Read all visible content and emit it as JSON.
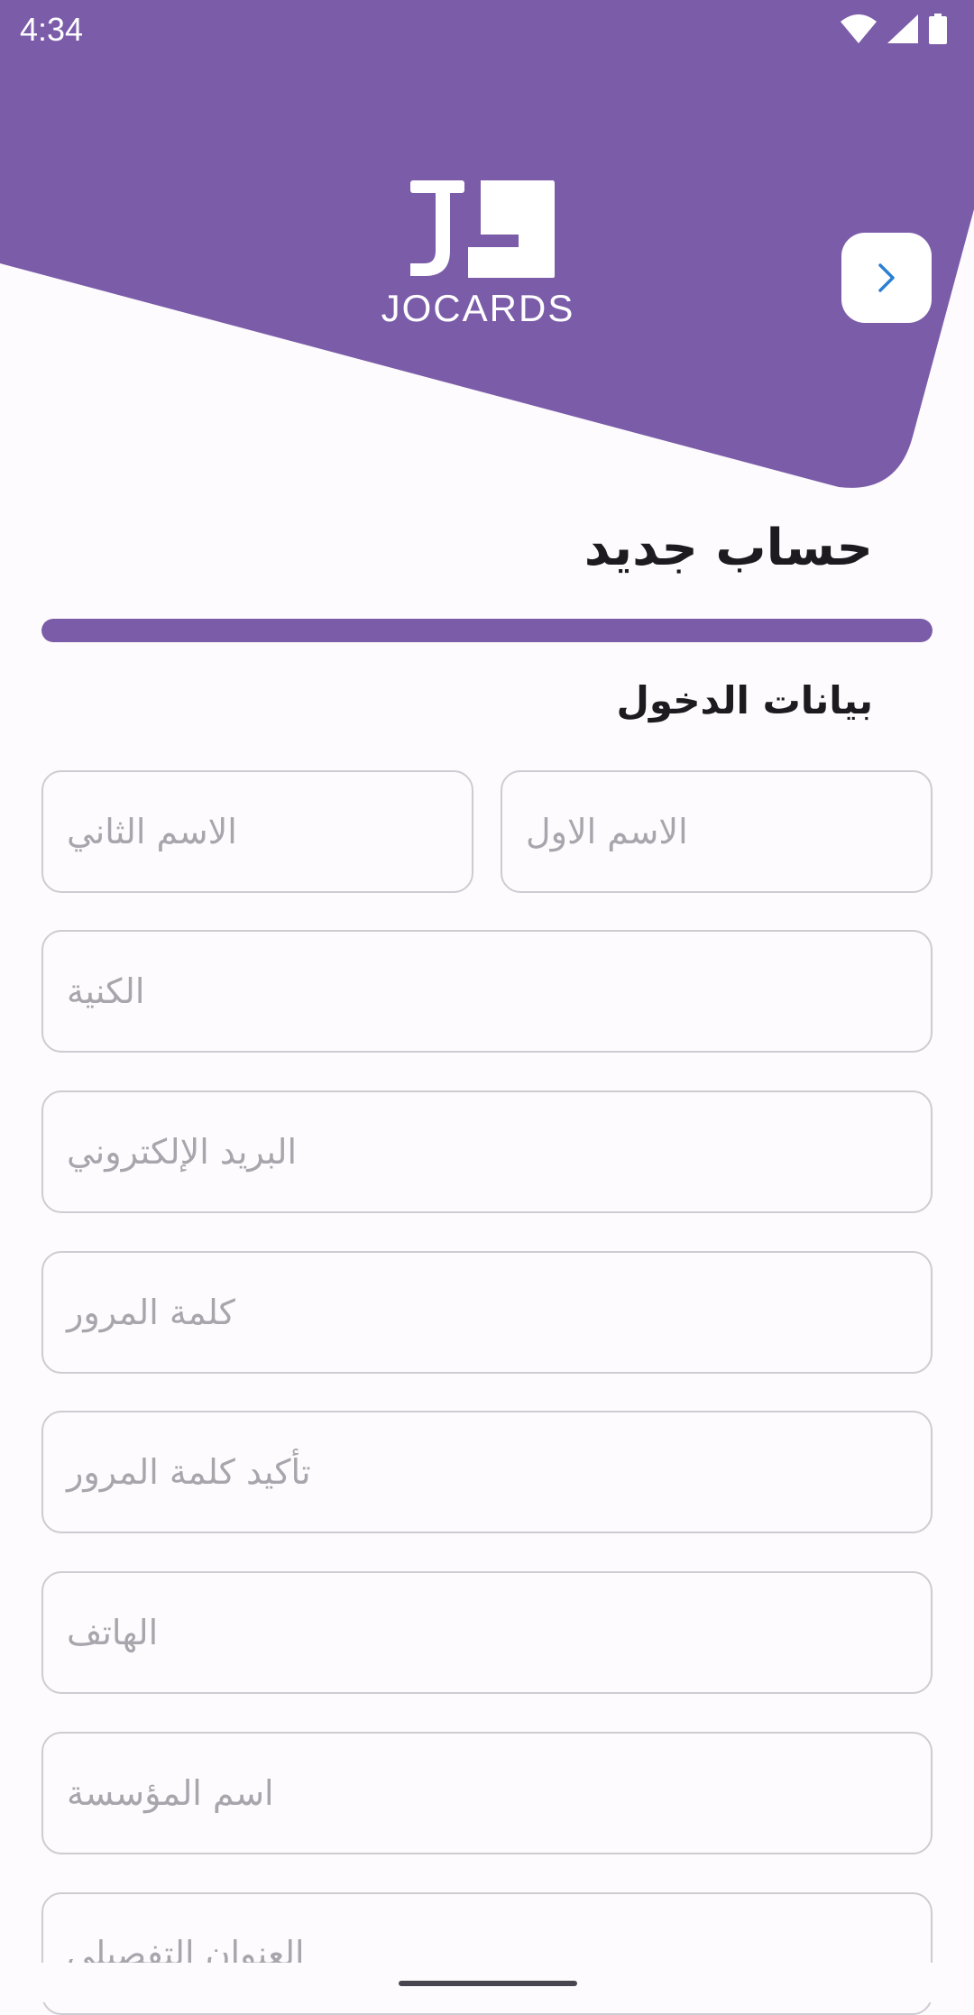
{
  "status_bar": {
    "time": "4:34",
    "icons": [
      "wifi-icon",
      "cell-signal-icon",
      "battery-icon"
    ]
  },
  "header": {
    "brand_name": "JOCARDS",
    "next_icon": "chevron-right-icon",
    "accent_color": "#7b5ca9"
  },
  "form": {
    "title": "حساب جديد",
    "progress": 1.0,
    "section_title": "بيانات الدخول",
    "first_name_placeholder": "الاسم الاول",
    "second_name_placeholder": "الاسم الثاني",
    "nickname_placeholder": "الكنية",
    "email_placeholder": "البريد الإلكتروني",
    "password_placeholder": "كلمة المرور",
    "confirm_password_placeholder": "تأكيد كلمة المرور",
    "phone_placeholder": "الهاتف",
    "organization_placeholder": "اسم المؤسسة",
    "address_placeholder": "العنوان التفصيلي"
  }
}
